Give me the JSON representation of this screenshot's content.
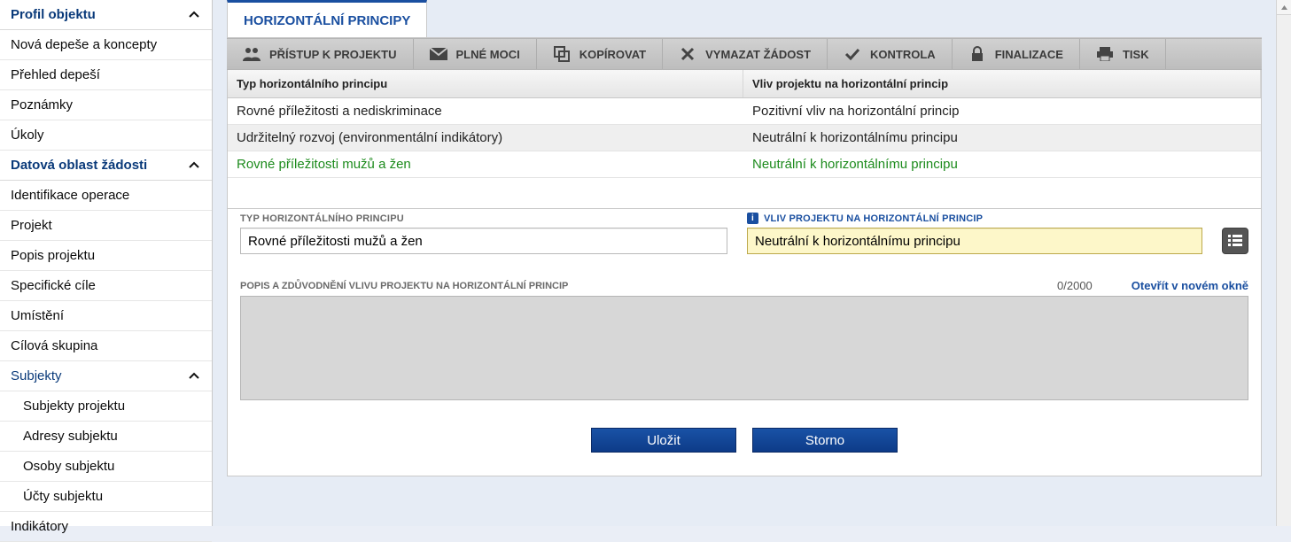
{
  "sidebar": {
    "section1": {
      "title": "Profil objektu",
      "items": [
        "Nová depeše a koncepty",
        "Přehled depeší",
        "Poznámky",
        "Úkoly"
      ]
    },
    "section2": {
      "title": "Datová oblast žádosti",
      "items": [
        "Identifikace operace",
        "Projekt",
        "Popis projektu",
        "Specifické cíle",
        "Umístění",
        "Cílová skupina"
      ],
      "sub": {
        "title": "Subjekty",
        "items": [
          "Subjekty projektu",
          "Adresy subjektu",
          "Osoby subjektu",
          "Účty subjektu"
        ]
      },
      "items_after": [
        "Indikátory"
      ]
    }
  },
  "page": {
    "title": "HORIZONTÁLNÍ PRINCIPY"
  },
  "toolbar": {
    "access": "PŘÍSTUP K PROJEKTU",
    "mandates": "PLNÉ MOCI",
    "copy": "KOPÍROVAT",
    "delete": "VYMAZAT ŽÁDOST",
    "check": "KONTROLA",
    "finalize": "FINALIZACE",
    "print": "TISK"
  },
  "table": {
    "col_type": "Typ horizontálního principu",
    "col_impact": "Vliv projektu na horizontální princip",
    "rows": [
      {
        "type": "Rovné příležitosti a nediskriminace",
        "impact": "Pozitivní vliv na horizontální princip"
      },
      {
        "type": "Udržitelný rozvoj (environmentální indikátory)",
        "impact": "Neutrální k horizontálnímu principu"
      },
      {
        "type": "Rovné příležitosti mužů a žen",
        "impact": "Neutrální k horizontálnímu principu"
      }
    ]
  },
  "form": {
    "type_label": "TYP HORIZONTÁLNÍHO PRINCIPU",
    "type_value": "Rovné příležitosti mužů a žen",
    "impact_label": "VLIV PROJEKTU NA HORIZONTÁLNÍ PRINCIP",
    "impact_value": "Neutrální k horizontálnímu principu",
    "desc_label": "POPIS A ZDŮVODNĚNÍ VLIVU PROJEKTU NA HORIZONTÁLNÍ PRINCIP",
    "char_count": "0/2000",
    "open_new": "Otevřít v novém okně",
    "desc_value": ""
  },
  "buttons": {
    "save": "Uložit",
    "cancel": "Storno"
  }
}
